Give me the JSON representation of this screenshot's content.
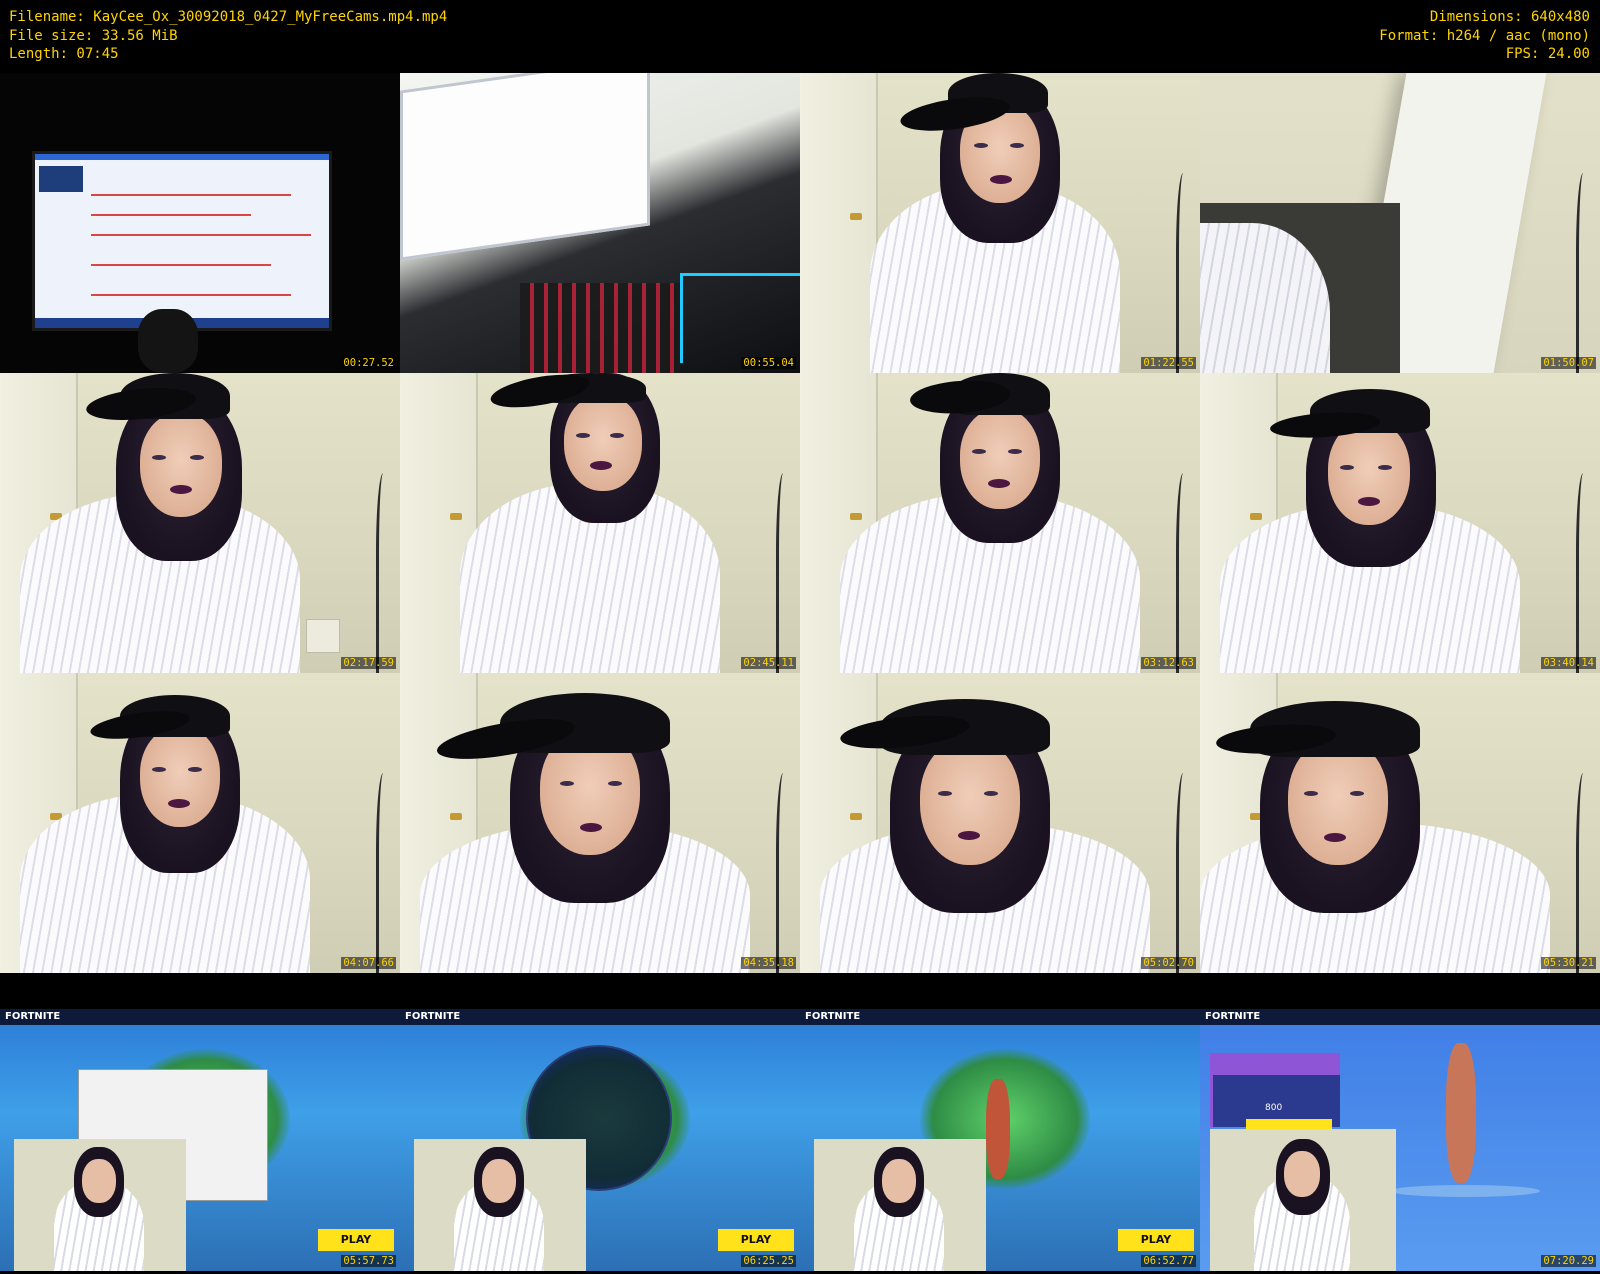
{
  "header": {
    "filename_line": "Filename: KayCee_Ox_30092018_0427_MyFreeCams.mp4.mp4",
    "filesize_line": "File size: 33.56 MiB",
    "length_line": "Length: 07:45",
    "dimensions_line": "Dimensions: 640x480",
    "format_line": "Format: h264 / aac (mono)",
    "fps_line": "FPS: 24.00"
  },
  "thumbnails": [
    {
      "timestamp": "00:27.52",
      "scene": "monitor-dark"
    },
    {
      "timestamp": "00:55.04",
      "scene": "monitor-keyboard"
    },
    {
      "timestamp": "01:22.55",
      "scene": "person"
    },
    {
      "timestamp": "01:50.07",
      "scene": "room-blur"
    },
    {
      "timestamp": "02:17.59",
      "scene": "person"
    },
    {
      "timestamp": "02:45.11",
      "scene": "person"
    },
    {
      "timestamp": "03:12.63",
      "scene": "person"
    },
    {
      "timestamp": "03:40.14",
      "scene": "person"
    },
    {
      "timestamp": "04:07.66",
      "scene": "person"
    },
    {
      "timestamp": "04:35.18",
      "scene": "person"
    },
    {
      "timestamp": "05:02.70",
      "scene": "person"
    },
    {
      "timestamp": "05:30.21",
      "scene": "person"
    },
    {
      "timestamp": "05:57.73",
      "scene": "fortnite"
    },
    {
      "timestamp": "06:25.25",
      "scene": "fortnite"
    },
    {
      "timestamp": "06:52.77",
      "scene": "fortnite"
    },
    {
      "timestamp": "07:20.29",
      "scene": "fortnite-shop"
    }
  ],
  "fortnite": {
    "logo": "FORTNITE",
    "play_label": "PLAY",
    "shop_price": "800"
  }
}
